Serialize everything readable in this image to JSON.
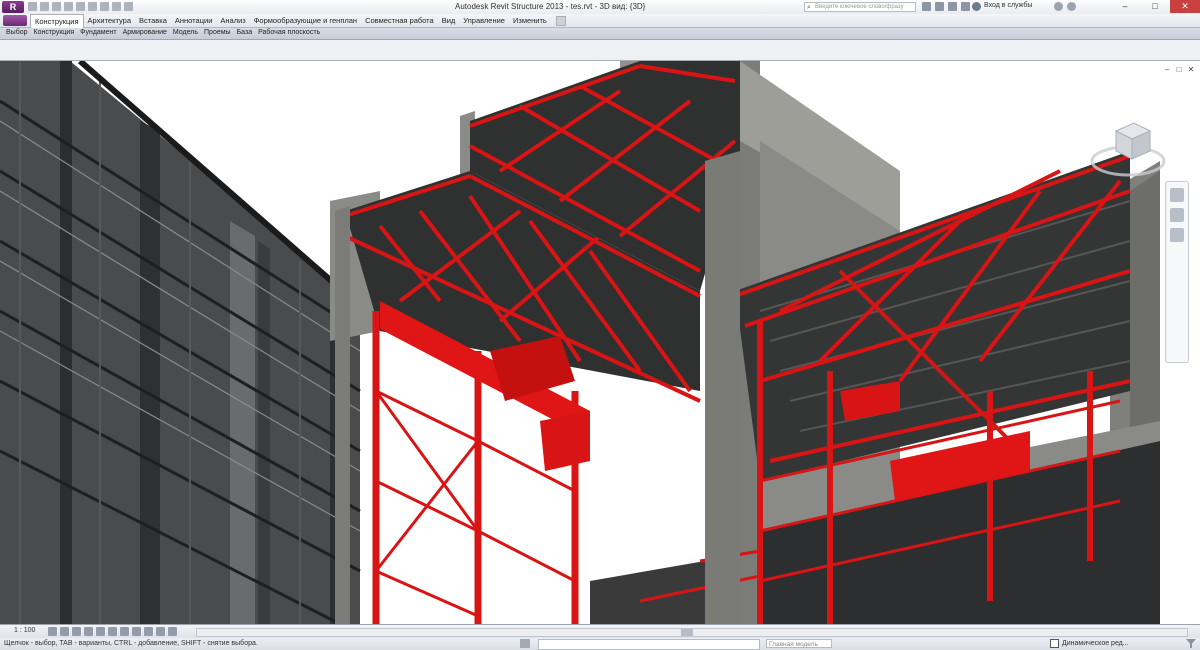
{
  "window": {
    "title": "Autodesk Revit Structure 2013 -   tes.rvt - 3D вид: {3D}",
    "search_placeholder": "Введите ключевое слово/фразу",
    "sign_in": "Вход в службы"
  },
  "ribbon": {
    "tabs": [
      "Конструкция",
      "Архитектура",
      "Вставка",
      "Аннотации",
      "Анализ",
      "Формообразующие и генплан",
      "Совместная работа",
      "Вид",
      "Управление",
      "Изменить"
    ],
    "active_tab": "Конструкция",
    "panels": [
      "Выбор",
      "Конструкция",
      "Фундамент",
      "Армирование",
      "Модель",
      "Проемы",
      "База",
      "Рабочая плоскость"
    ]
  },
  "viewbar": {
    "scale": "1 : 100"
  },
  "statusbar": {
    "hint": "Щелчок - выбор, TAB - варианты, CTRL - добавление, SHIFT - снятие выбора.",
    "model_field": "Главная модель",
    "option_label": "Динамическое ред..."
  },
  "icons": {
    "app": "revit-logo-icon",
    "search": "search-icon",
    "filter": "filter-icon",
    "viewcube": "viewcube-icon"
  },
  "colors": {
    "accent_red": "#d81414",
    "concrete": "#8a8b86",
    "dark_frame": "#3a3a3a",
    "app_purple": "#7a3581"
  }
}
